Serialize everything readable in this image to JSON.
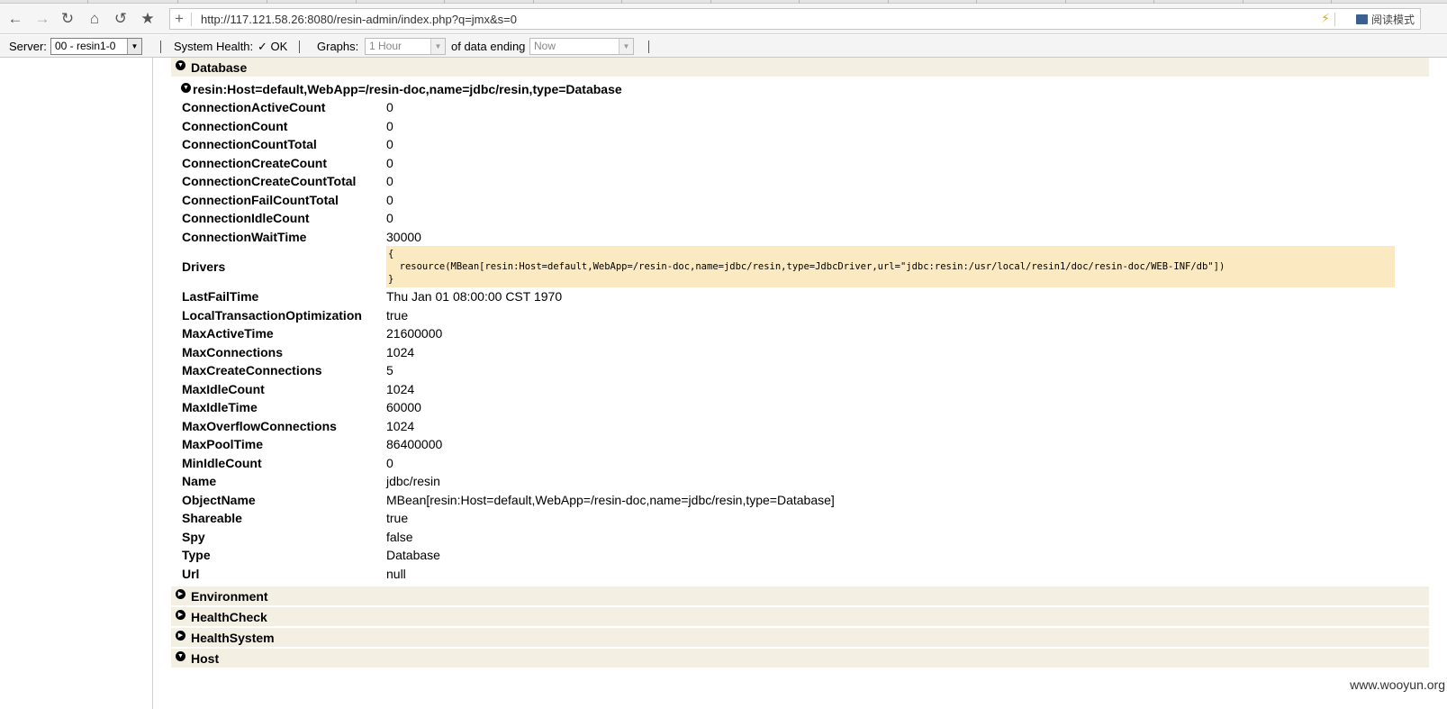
{
  "browser": {
    "address": "http://117.121.58.26:8080/resin-admin/index.php?q=jmx&s=0",
    "read_mode_label": "阅读模式"
  },
  "toolbar": {
    "server_label": "Server:",
    "server_value": "00 - resin1-0",
    "health_label": "System Health:",
    "health_status": "✓ OK",
    "graphs_label": "Graphs:",
    "graphs_value": "1 Hour",
    "data_ending_label": "of data ending",
    "data_ending_value": "Now"
  },
  "sections": {
    "database": "Database",
    "environment": "Environment",
    "healthcheck": "HealthCheck",
    "healthsystem": "HealthSystem",
    "host": "Host"
  },
  "mbean": {
    "title": "resin:Host=default,WebApp=/resin-doc,name=jdbc/resin,type=Database",
    "attrs_top": [
      {
        "key": "ConnectionActiveCount",
        "value": "0"
      },
      {
        "key": "ConnectionCount",
        "value": "0"
      },
      {
        "key": "ConnectionCountTotal",
        "value": "0"
      },
      {
        "key": "ConnectionCreateCount",
        "value": "0"
      },
      {
        "key": "ConnectionCreateCountTotal",
        "value": "0"
      },
      {
        "key": "ConnectionFailCountTotal",
        "value": "0"
      },
      {
        "key": "ConnectionIdleCount",
        "value": "0"
      },
      {
        "key": "ConnectionWaitTime",
        "value": "30000"
      }
    ],
    "drivers": {
      "key": "Drivers",
      "value": "{\n  resource(MBean[resin:Host=default,WebApp=/resin-doc,name=jdbc/resin,type=JdbcDriver,url=\"jdbc:resin:/usr/local/resin1/doc/resin-doc/WEB-INF/db\"])\n}"
    },
    "attrs_bottom": [
      {
        "key": "LastFailTime",
        "value": "Thu Jan 01 08:00:00 CST 1970"
      },
      {
        "key": "LocalTransactionOptimization",
        "value": "true"
      },
      {
        "key": "MaxActiveTime",
        "value": "21600000"
      },
      {
        "key": "MaxConnections",
        "value": "1024"
      },
      {
        "key": "MaxCreateConnections",
        "value": "5"
      },
      {
        "key": "MaxIdleCount",
        "value": "1024"
      },
      {
        "key": "MaxIdleTime",
        "value": "60000"
      },
      {
        "key": "MaxOverflowConnections",
        "value": "1024"
      },
      {
        "key": "MaxPoolTime",
        "value": "86400000"
      },
      {
        "key": "MinIdleCount",
        "value": "0"
      },
      {
        "key": "Name",
        "value": "jdbc/resin"
      },
      {
        "key": "ObjectName",
        "value": "MBean[resin:Host=default,WebApp=/resin-doc,name=jdbc/resin,type=Database]"
      },
      {
        "key": "Shareable",
        "value": "true"
      },
      {
        "key": "Spy",
        "value": "false"
      },
      {
        "key": "Type",
        "value": "Database"
      },
      {
        "key": "Url",
        "value": "null"
      }
    ]
  },
  "watermark": "www.wooyun.org"
}
